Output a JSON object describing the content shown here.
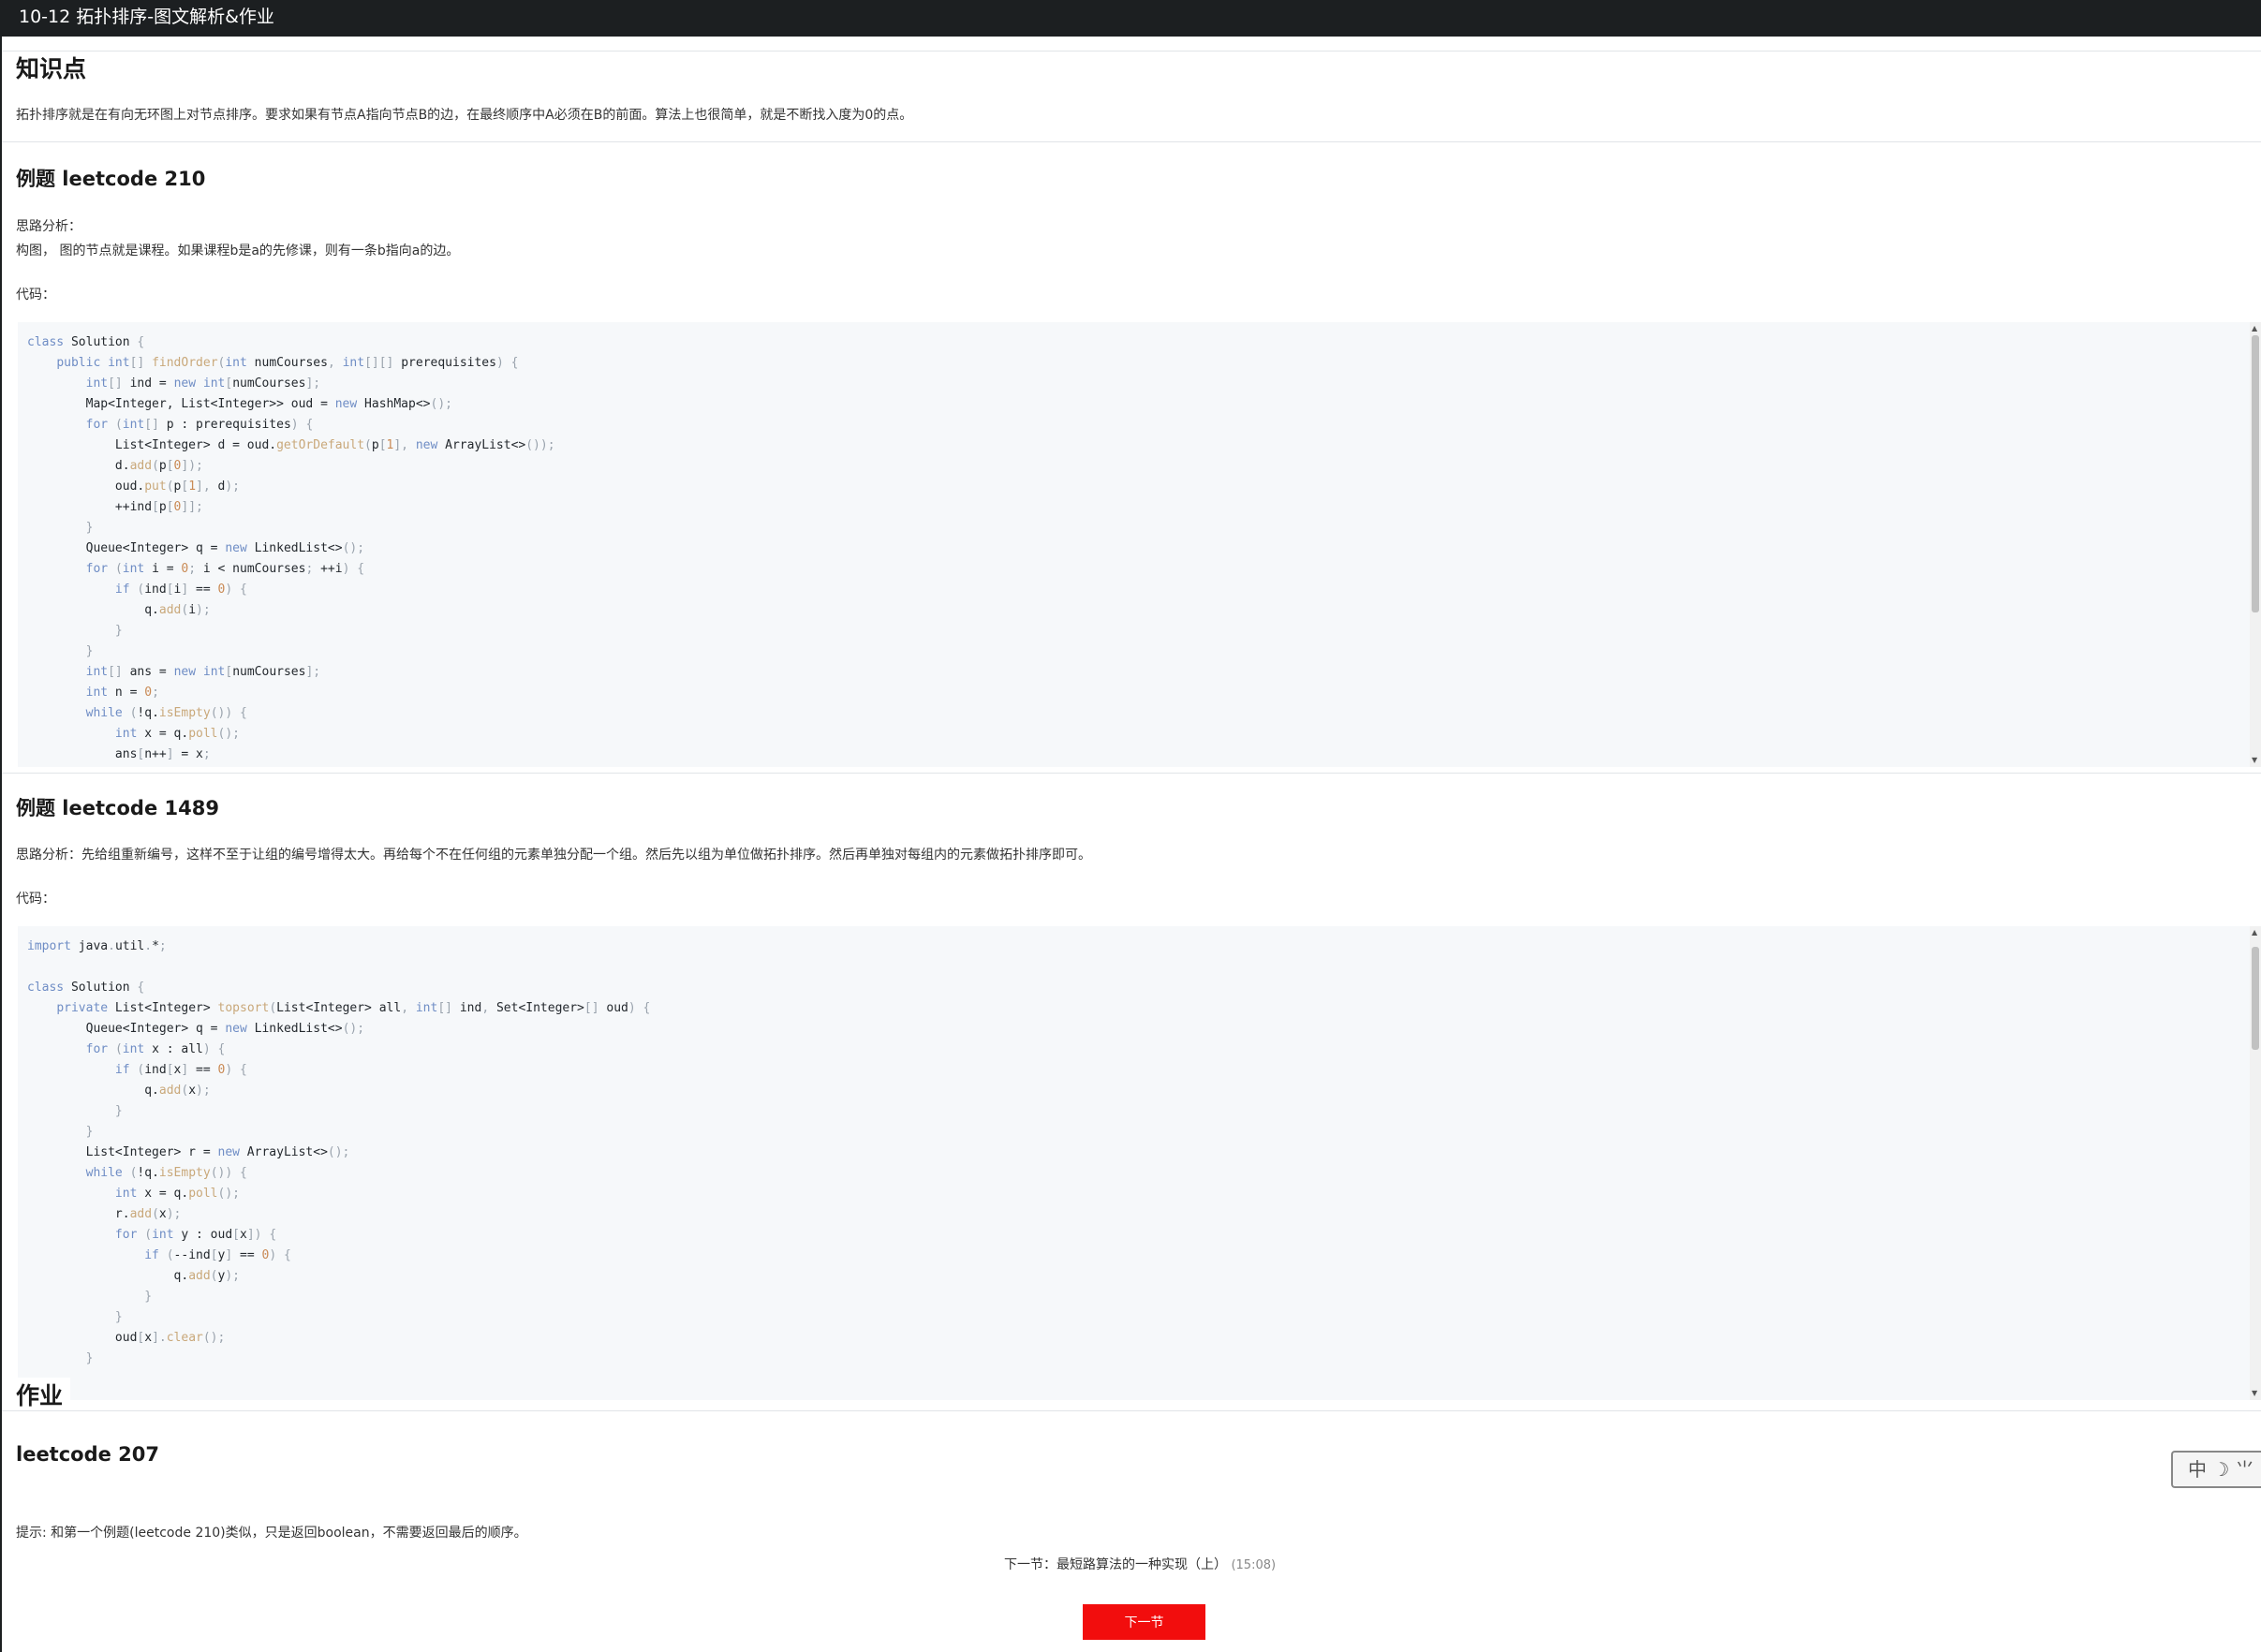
{
  "header": {
    "title": "10-12 拓扑排序-图文解析&作业"
  },
  "sections": {
    "knowledge": {
      "heading": "知识点",
      "text": "拓扑排序就是在有向无环图上对节点排序。要求如果有节点A指向节点B的边，在最终顺序中A必须在B的前面。算法上也很简单，就是不断找入度为0的点。"
    },
    "ex1": {
      "heading": "例题 leetcode 210",
      "analysis_label": "思路分析：",
      "analysis_text": "构图， 图的节点就是课程。如果课程b是a的先修课，则有一条b指向a的边。",
      "code_label": "代码："
    },
    "ex2": {
      "heading": "例题 leetcode 1489",
      "analysis_text": "思路分析：先给组重新编号，这样不至于让组的编号增得太大。再给每个不在任何组的元素单独分配一个组。然后先以组为单位做拓扑排序。然后再单独对每组内的元素做拓扑排序即可。",
      "code_label": "代码："
    },
    "homework": {
      "heading": "作业",
      "subheading": "leetcode 207",
      "hint": "提示: 和第一个例题(leetcode 210)类似，只是返回boolean，不需要返回最后的顺序。"
    }
  },
  "code1": [
    [
      [
        "kw",
        "class"
      ],
      [
        "tx",
        " Solution "
      ],
      [
        "pn",
        "{"
      ]
    ],
    [
      [
        "tx",
        "    "
      ],
      [
        "kw",
        "public"
      ],
      [
        "tx",
        " "
      ],
      [
        "kw",
        "int"
      ],
      [
        "pn",
        "[]"
      ],
      [
        "tx",
        " "
      ],
      [
        "fn",
        "findOrder"
      ],
      [
        "pn",
        "("
      ],
      [
        "kw",
        "int"
      ],
      [
        "tx",
        " numCourses"
      ],
      [
        "pn",
        ","
      ],
      [
        "tx",
        " "
      ],
      [
        "kw",
        "int"
      ],
      [
        "pn",
        "[][]"
      ],
      [
        "tx",
        " prerequisites"
      ],
      [
        "pn",
        ")"
      ],
      [
        "tx",
        " "
      ],
      [
        "pn",
        "{"
      ]
    ],
    [
      [
        "tx",
        "        "
      ],
      [
        "kw",
        "int"
      ],
      [
        "pn",
        "[]"
      ],
      [
        "tx",
        " ind = "
      ],
      [
        "kw",
        "new"
      ],
      [
        "tx",
        " "
      ],
      [
        "kw",
        "int"
      ],
      [
        "pn",
        "["
      ],
      [
        "tx",
        "numCourses"
      ],
      [
        "pn",
        "];"
      ]
    ],
    [
      [
        "tx",
        "        Map<Integer, List<Integer>> oud = "
      ],
      [
        "kw",
        "new"
      ],
      [
        "tx",
        " HashMap<>"
      ],
      [
        "pn",
        "();"
      ]
    ],
    [
      [
        "tx",
        "        "
      ],
      [
        "kw",
        "for"
      ],
      [
        "tx",
        " "
      ],
      [
        "pn",
        "("
      ],
      [
        "kw",
        "int"
      ],
      [
        "pn",
        "[]"
      ],
      [
        "tx",
        " p : prerequisites"
      ],
      [
        "pn",
        ")"
      ],
      [
        "tx",
        " "
      ],
      [
        "pn",
        "{"
      ]
    ],
    [
      [
        "tx",
        "            List<Integer> d = oud."
      ],
      [
        "fn",
        "getOrDefault"
      ],
      [
        "pn",
        "("
      ],
      [
        "tx",
        "p"
      ],
      [
        "pn",
        "["
      ],
      [
        "nm",
        "1"
      ],
      [
        "pn",
        "],"
      ],
      [
        "tx",
        " "
      ],
      [
        "kw",
        "new"
      ],
      [
        "tx",
        " ArrayList<>"
      ],
      [
        "pn",
        "());"
      ]
    ],
    [
      [
        "tx",
        "            d."
      ],
      [
        "fn",
        "add"
      ],
      [
        "pn",
        "("
      ],
      [
        "tx",
        "p"
      ],
      [
        "pn",
        "["
      ],
      [
        "nm",
        "0"
      ],
      [
        "pn",
        "]);"
      ]
    ],
    [
      [
        "tx",
        "            oud."
      ],
      [
        "fn",
        "put"
      ],
      [
        "pn",
        "("
      ],
      [
        "tx",
        "p"
      ],
      [
        "pn",
        "["
      ],
      [
        "nm",
        "1"
      ],
      [
        "pn",
        "],"
      ],
      [
        "tx",
        " d"
      ],
      [
        "pn",
        ");"
      ]
    ],
    [
      [
        "tx",
        "            ++ind"
      ],
      [
        "pn",
        "["
      ],
      [
        "tx",
        "p"
      ],
      [
        "pn",
        "["
      ],
      [
        "nm",
        "0"
      ],
      [
        "pn",
        "]];"
      ]
    ],
    [
      [
        "tx",
        "        "
      ],
      [
        "pn",
        "}"
      ]
    ],
    [
      [
        "tx",
        "        Queue<Integer> q = "
      ],
      [
        "kw",
        "new"
      ],
      [
        "tx",
        " LinkedList<>"
      ],
      [
        "pn",
        "();"
      ]
    ],
    [
      [
        "tx",
        "        "
      ],
      [
        "kw",
        "for"
      ],
      [
        "tx",
        " "
      ],
      [
        "pn",
        "("
      ],
      [
        "kw",
        "int"
      ],
      [
        "tx",
        " i = "
      ],
      [
        "nm",
        "0"
      ],
      [
        "pn",
        ";"
      ],
      [
        "tx",
        " i < numCourses"
      ],
      [
        "pn",
        ";"
      ],
      [
        "tx",
        " ++i"
      ],
      [
        "pn",
        ")"
      ],
      [
        "tx",
        " "
      ],
      [
        "pn",
        "{"
      ]
    ],
    [
      [
        "tx",
        "            "
      ],
      [
        "kw",
        "if"
      ],
      [
        "tx",
        " "
      ],
      [
        "pn",
        "("
      ],
      [
        "tx",
        "ind"
      ],
      [
        "pn",
        "["
      ],
      [
        "tx",
        "i"
      ],
      [
        "pn",
        "]"
      ],
      [
        "tx",
        " == "
      ],
      [
        "nm",
        "0"
      ],
      [
        "pn",
        ")"
      ],
      [
        "tx",
        " "
      ],
      [
        "pn",
        "{"
      ]
    ],
    [
      [
        "tx",
        "                q."
      ],
      [
        "fn",
        "add"
      ],
      [
        "pn",
        "("
      ],
      [
        "tx",
        "i"
      ],
      [
        "pn",
        ");"
      ]
    ],
    [
      [
        "tx",
        "            "
      ],
      [
        "pn",
        "}"
      ]
    ],
    [
      [
        "tx",
        "        "
      ],
      [
        "pn",
        "}"
      ]
    ],
    [
      [
        "tx",
        "        "
      ],
      [
        "kw",
        "int"
      ],
      [
        "pn",
        "[]"
      ],
      [
        "tx",
        " ans = "
      ],
      [
        "kw",
        "new"
      ],
      [
        "tx",
        " "
      ],
      [
        "kw",
        "int"
      ],
      [
        "pn",
        "["
      ],
      [
        "tx",
        "numCourses"
      ],
      [
        "pn",
        "];"
      ]
    ],
    [
      [
        "tx",
        "        "
      ],
      [
        "kw",
        "int"
      ],
      [
        "tx",
        " n = "
      ],
      [
        "nm",
        "0"
      ],
      [
        "pn",
        ";"
      ]
    ],
    [
      [
        "tx",
        "        "
      ],
      [
        "kw",
        "while"
      ],
      [
        "tx",
        " "
      ],
      [
        "pn",
        "("
      ],
      [
        "tx",
        "!q."
      ],
      [
        "fn",
        "isEmpty"
      ],
      [
        "pn",
        "())"
      ],
      [
        "tx",
        " "
      ],
      [
        "pn",
        "{"
      ]
    ],
    [
      [
        "tx",
        "            "
      ],
      [
        "kw",
        "int"
      ],
      [
        "tx",
        " x = q."
      ],
      [
        "fn",
        "poll"
      ],
      [
        "pn",
        "();"
      ]
    ],
    [
      [
        "tx",
        "            ans"
      ],
      [
        "pn",
        "["
      ],
      [
        "tx",
        "n++"
      ],
      [
        "pn",
        "]"
      ],
      [
        "tx",
        " = x"
      ],
      [
        "pn",
        ";"
      ]
    ]
  ],
  "code2": [
    [
      [
        "kw",
        "import"
      ],
      [
        "tx",
        " java"
      ],
      [
        "pn",
        "."
      ],
      [
        "tx",
        "util"
      ],
      [
        "pn",
        "."
      ],
      [
        "tx",
        "*"
      ],
      [
        "pn",
        ";"
      ]
    ],
    [
      [
        "tx",
        ""
      ]
    ],
    [
      [
        "kw",
        "class"
      ],
      [
        "tx",
        " Solution "
      ],
      [
        "pn",
        "{"
      ]
    ],
    [
      [
        "tx",
        "    "
      ],
      [
        "kw",
        "private"
      ],
      [
        "tx",
        " List<Integer> "
      ],
      [
        "fn",
        "topsort"
      ],
      [
        "pn",
        "("
      ],
      [
        "tx",
        "List<Integer> all"
      ],
      [
        "pn",
        ","
      ],
      [
        "tx",
        " "
      ],
      [
        "kw",
        "int"
      ],
      [
        "pn",
        "[]"
      ],
      [
        "tx",
        " ind"
      ],
      [
        "pn",
        ","
      ],
      [
        "tx",
        " Set<Integer>"
      ],
      [
        "pn",
        "[]"
      ],
      [
        "tx",
        " oud"
      ],
      [
        "pn",
        ")"
      ],
      [
        "tx",
        " "
      ],
      [
        "pn",
        "{"
      ]
    ],
    [
      [
        "tx",
        "        Queue<Integer> q = "
      ],
      [
        "kw",
        "new"
      ],
      [
        "tx",
        " LinkedList<>"
      ],
      [
        "pn",
        "();"
      ]
    ],
    [
      [
        "tx",
        "        "
      ],
      [
        "kw",
        "for"
      ],
      [
        "tx",
        " "
      ],
      [
        "pn",
        "("
      ],
      [
        "kw",
        "int"
      ],
      [
        "tx",
        " x : all"
      ],
      [
        "pn",
        ")"
      ],
      [
        "tx",
        " "
      ],
      [
        "pn",
        "{"
      ]
    ],
    [
      [
        "tx",
        "            "
      ],
      [
        "kw",
        "if"
      ],
      [
        "tx",
        " "
      ],
      [
        "pn",
        "("
      ],
      [
        "tx",
        "ind"
      ],
      [
        "pn",
        "["
      ],
      [
        "tx",
        "x"
      ],
      [
        "pn",
        "]"
      ],
      [
        "tx",
        " == "
      ],
      [
        "nm",
        "0"
      ],
      [
        "pn",
        ")"
      ],
      [
        "tx",
        " "
      ],
      [
        "pn",
        "{"
      ]
    ],
    [
      [
        "tx",
        "                q."
      ],
      [
        "fn",
        "add"
      ],
      [
        "pn",
        "("
      ],
      [
        "tx",
        "x"
      ],
      [
        "pn",
        ");"
      ]
    ],
    [
      [
        "tx",
        "            "
      ],
      [
        "pn",
        "}"
      ]
    ],
    [
      [
        "tx",
        "        "
      ],
      [
        "pn",
        "}"
      ]
    ],
    [
      [
        "tx",
        "        List<Integer> r = "
      ],
      [
        "kw",
        "new"
      ],
      [
        "tx",
        " ArrayList<>"
      ],
      [
        "pn",
        "();"
      ]
    ],
    [
      [
        "tx",
        "        "
      ],
      [
        "kw",
        "while"
      ],
      [
        "tx",
        " "
      ],
      [
        "pn",
        "("
      ],
      [
        "tx",
        "!q."
      ],
      [
        "fn",
        "isEmpty"
      ],
      [
        "pn",
        "())"
      ],
      [
        "tx",
        " "
      ],
      [
        "pn",
        "{"
      ]
    ],
    [
      [
        "tx",
        "            "
      ],
      [
        "kw",
        "int"
      ],
      [
        "tx",
        " x = q."
      ],
      [
        "fn",
        "poll"
      ],
      [
        "pn",
        "();"
      ]
    ],
    [
      [
        "tx",
        "            r."
      ],
      [
        "fn",
        "add"
      ],
      [
        "pn",
        "("
      ],
      [
        "tx",
        "x"
      ],
      [
        "pn",
        ");"
      ]
    ],
    [
      [
        "tx",
        "            "
      ],
      [
        "kw",
        "for"
      ],
      [
        "tx",
        " "
      ],
      [
        "pn",
        "("
      ],
      [
        "kw",
        "int"
      ],
      [
        "tx",
        " y : oud"
      ],
      [
        "pn",
        "["
      ],
      [
        "tx",
        "x"
      ],
      [
        "pn",
        "])"
      ],
      [
        "tx",
        " "
      ],
      [
        "pn",
        "{"
      ]
    ],
    [
      [
        "tx",
        "                "
      ],
      [
        "kw",
        "if"
      ],
      [
        "tx",
        " "
      ],
      [
        "pn",
        "("
      ],
      [
        "tx",
        "--ind"
      ],
      [
        "pn",
        "["
      ],
      [
        "tx",
        "y"
      ],
      [
        "pn",
        "]"
      ],
      [
        "tx",
        " == "
      ],
      [
        "nm",
        "0"
      ],
      [
        "pn",
        ")"
      ],
      [
        "tx",
        " "
      ],
      [
        "pn",
        "{"
      ]
    ],
    [
      [
        "tx",
        "                    q."
      ],
      [
        "fn",
        "add"
      ],
      [
        "pn",
        "("
      ],
      [
        "tx",
        "y"
      ],
      [
        "pn",
        ");"
      ]
    ],
    [
      [
        "tx",
        "                "
      ],
      [
        "pn",
        "}"
      ]
    ],
    [
      [
        "tx",
        "            "
      ],
      [
        "pn",
        "}"
      ]
    ],
    [
      [
        "tx",
        "            oud"
      ],
      [
        "pn",
        "["
      ],
      [
        "tx",
        "x"
      ],
      [
        "pn",
        "]."
      ],
      [
        "fn",
        "clear"
      ],
      [
        "pn",
        "();"
      ]
    ],
    [
      [
        "tx",
        "        "
      ],
      [
        "pn",
        "}"
      ]
    ]
  ],
  "footer": {
    "next_label": "下一节：最短路算法的一种实现（上）",
    "next_duration": "(15:08)",
    "next_button": "下一节"
  },
  "ime": {
    "text": "中 ☽ ⺌"
  },
  "colors": {
    "topbar": "#1c1f21",
    "code_bg": "#f6f8fa",
    "keyword": "#6f8dc5",
    "function": "#c9a87a",
    "button": "#f20d0d"
  }
}
